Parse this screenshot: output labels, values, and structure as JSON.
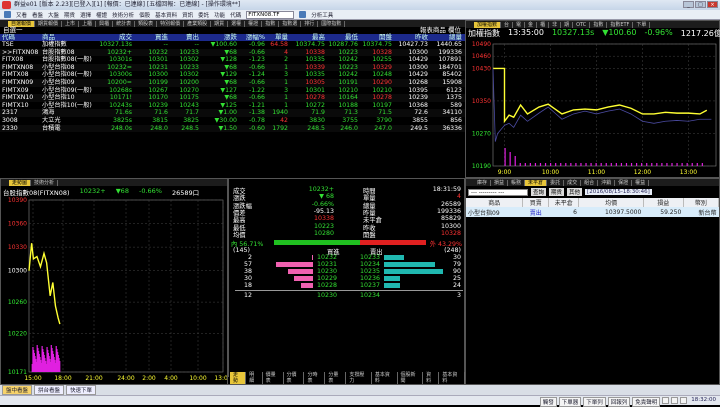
{
  "window": {
    "title": "群益e01 [版本 2.23][已登入][1] [報價：已連線] [五檔回報：已連線] - [操作環境**]",
    "buttons": [
      "_",
      "□",
      "×"
    ]
  },
  "toolbar": {
    "items": [
      "又看",
      "看盤",
      "大盤",
      "期貨",
      "選擇",
      "權證",
      "技術分析",
      "個股",
      "基本資料",
      "資訊",
      "委託",
      "功能"
    ],
    "code_label": "代碼",
    "code_value": "FITXN08.TF",
    "analysis": "分析工具"
  },
  "top_tabs": [
    "自選報價",
    "期貨報價",
    "上市",
    "上櫃",
    "興櫃",
    "統計表",
    "類股表",
    "特別報價",
    "產業類股",
    "期貨",
    "選權",
    "權證",
    "指數",
    "指數選",
    "排行",
    "國際指數"
  ],
  "watchlist": {
    "title": "自選一",
    "right_buttons": [
      "報表商品",
      "欄位"
    ],
    "headers": [
      "代碼",
      "商品",
      "成交",
      "買進",
      "賣出",
      "漲跌",
      "漲幅%",
      "單量",
      "最高",
      "最低",
      "開盤",
      "昨收",
      "總量"
    ],
    "rows": [
      [
        "TSE",
        "加權指數",
        "10327.13s",
        "--",
        "--",
        "▼100.60",
        "-0.96",
        "64.58",
        "10374.75",
        "10287.76",
        "10374.75",
        "10427.73",
        "1440.65"
      ],
      [
        ">>FITXN08",
        "台股指數08",
        "10232+",
        "10232",
        "10233",
        "▼68",
        "-0.66",
        "4",
        "10338",
        "10223",
        "10328",
        "10300",
        "199336"
      ],
      [
        "FITX08",
        "台股指數08(一般)",
        "10301s",
        "10301",
        "10302",
        "▼128",
        "-1.23",
        "2",
        "10335",
        "10242",
        "10255",
        "10429",
        "107891"
      ],
      [
        "FIMTXN08",
        "小型台指08",
        "10232=",
        "10231",
        "10233",
        "▼68",
        "-0.66",
        "1",
        "10339",
        "10223",
        "10329",
        "10300",
        "184701"
      ],
      [
        "FIMTX08",
        "小型台指08(一般)",
        "10300s",
        "10300",
        "10302",
        "▼129",
        "-1.24",
        "3",
        "10335",
        "10242",
        "10248",
        "10429",
        "85402"
      ],
      [
        "FIMTXN09",
        "小型台指09",
        "10200=",
        "10199",
        "10200",
        "▼68",
        "-0.66",
        "1",
        "10305",
        "10191",
        "10290",
        "10268",
        "15908"
      ],
      [
        "FIMTX09",
        "小型台指09(一般)",
        "10268s",
        "10267",
        "10270",
        "▼127",
        "-1.22",
        "3",
        "10301",
        "10210",
        "10210",
        "10395",
        "6123"
      ],
      [
        "FIMTXN10",
        "小型台指10",
        "10171!",
        "10170",
        "10175",
        "▼68",
        "-0.66",
        "1",
        "10278",
        "10164",
        "10278",
        "10239",
        "1375"
      ],
      [
        "FIMTX10",
        "小型台指10(一般)",
        "10243s",
        "10239",
        "10243",
        "▼125",
        "-1.21",
        "1",
        "10272",
        "10188",
        "10197",
        "10368",
        "589"
      ],
      [
        "2317",
        "鴻海",
        "71.6s",
        "71.6",
        "71.7",
        "▼1.00",
        "-1.38",
        "1940",
        "71.9",
        "71.3",
        "71.5",
        "72.6",
        "34110"
      ],
      [
        "3008",
        "大立光",
        "3825s",
        "3815",
        "3825",
        "▼30.00",
        "-0.78",
        "42",
        "3830",
        "3755",
        "3790",
        "3855",
        "856"
      ],
      [
        "2330",
        "台積電",
        "248.0s",
        "248.0",
        "248.5",
        "▼1.50",
        "-0.60",
        "1792",
        "248.5",
        "246.0",
        "247.0",
        "249.5",
        "36336"
      ]
    ]
  },
  "index_chart": {
    "tabs": [
      "加權指數",
      "台",
      "電",
      "金",
      "櫃",
      "非",
      "期",
      "OTC",
      "指數",
      "指數ETF",
      "下單"
    ],
    "name": "加權指數",
    "time": "13:35:00",
    "price": "10327.13s",
    "change": "▼100.60",
    "pct": "-0.96%",
    "amount": "1217.26億"
  },
  "futures_chart": {
    "tabs": [
      "走勢圖",
      "技術分析"
    ],
    "name": "台股指數08(FITXN08)",
    "price": "10232+",
    "change": "▼68",
    "pct": "-0.66%",
    "volume": "26589口",
    "bottom_tabs": [
      "走勢",
      "明細",
      "價量表",
      "分價表",
      "分時表",
      "分量表",
      "支撐壓力",
      "基本資料",
      "個股新聞",
      "資料",
      "基本資料"
    ]
  },
  "chart_data": [
    {
      "type": "line",
      "title": "加權指數",
      "y_ticks": [
        10490,
        10460,
        10430,
        10350,
        10270,
        10190
      ],
      "ylim": [
        10190,
        10490
      ],
      "x_ticks": [
        "9:00",
        "10:00",
        "11:00",
        "12:00",
        "13:00"
      ],
      "xlim": [
        8.75,
        13.6
      ],
      "series": [
        {
          "name": "加權指數",
          "color": "#ffff33",
          "x": [
            8.75,
            9.0,
            9.0,
            9.1,
            9.2,
            9.35,
            9.5,
            9.75,
            9.95,
            10.1,
            10.25,
            10.5,
            10.75,
            11.0,
            11.25,
            11.5,
            11.75,
            12.0,
            12.25,
            12.5,
            12.75,
            13.0,
            13.25,
            13.4
          ],
          "y": [
            10430,
            10430,
            10300,
            10315,
            10310,
            10340,
            10318,
            10335,
            10342,
            10330,
            10318,
            10328,
            10330,
            10328,
            10335,
            10340,
            10332,
            10318,
            10318,
            10322,
            10320,
            10320,
            10318,
            10327
          ]
        },
        {
          "name": "未加權",
          "color": "#4a4aa0",
          "x": [
            8.75,
            8.8,
            8.85,
            9.0,
            9.1,
            9.2,
            9.35,
            9.5,
            9.75,
            9.95,
            10.1,
            10.25,
            10.5,
            10.75,
            11.0,
            11.25,
            11.5,
            11.75,
            12.0,
            12.25,
            12.5,
            12.75,
            13.0,
            13.25,
            13.5
          ],
          "y": [
            10430,
            10250,
            10270,
            10290,
            10295,
            10285,
            10315,
            10300,
            10320,
            10335,
            10320,
            10305,
            10318,
            10325,
            10318,
            10325,
            10330,
            10318,
            10300,
            10295,
            10300,
            10302,
            10300,
            10305,
            10305
          ]
        }
      ]
    },
    {
      "type": "line",
      "title": "台股指數08(FITXN08)",
      "y_ticks": [
        10390,
        10360,
        10330,
        10300,
        10260,
        10220,
        10171
      ],
      "ylim": [
        10171,
        10390
      ],
      "x_ticks": [
        "15:00",
        "18:00",
        "21:00",
        "24:00",
        "2:00",
        "4:00",
        "10:00",
        "13:00"
      ],
      "series": [
        {
          "name": "FITXN08",
          "color": "#ffff33",
          "x": [
            0,
            0.3,
            0.5,
            0.9,
            1.3,
            1.7,
            2.0,
            2.4,
            2.7,
            3.0,
            3.3,
            3.5
          ],
          "y": [
            10300,
            10335,
            10315,
            10318,
            10305,
            10322,
            10310,
            10268,
            10285,
            10255,
            10240,
            10232
          ]
        }
      ]
    }
  ],
  "quote": {
    "left": [
      [
        "成交",
        "10232+"
      ],
      [
        "漲跌",
        "▼ 68"
      ],
      [
        "漲跌幅",
        "-0.66%"
      ],
      [
        "價差",
        "-95.13"
      ],
      [
        "最高",
        "10338"
      ],
      [
        "最低",
        "10223"
      ],
      [
        "均價",
        "10280"
      ]
    ],
    "right": [
      [
        "時間",
        "18:31:59"
      ],
      [
        "單量",
        "4"
      ],
      [
        "總量",
        "26589"
      ],
      [
        "昨量",
        "199336"
      ],
      [
        "未平倉",
        "85829"
      ],
      [
        "昨收",
        "10300"
      ],
      [
        "開盤",
        "10328"
      ]
    ],
    "inner_label": "內 56.71%",
    "outer_label": "外 43.29%",
    "inner_ratio": 0.5671,
    "bid_total": "(145)",
    "ask_total": "(248)",
    "bid_header": "買進",
    "ask_header": "賣出",
    "book": [
      [
        "2",
        "10232",
        "10233",
        "30"
      ],
      [
        "57",
        "10231",
        "10234",
        "79"
      ],
      [
        "38",
        "10230",
        "10235",
        "90"
      ],
      [
        "30",
        "10229",
        "10236",
        "25"
      ],
      [
        "18",
        "10228",
        "10237",
        "24"
      ]
    ],
    "summary": [
      "12",
      "10230",
      "10234",
      "3"
    ]
  },
  "positions": {
    "tabs": [
      "庫存",
      "損益",
      "帳務",
      "未平倉",
      "委託",
      "成交",
      "組合",
      "沖銷",
      "保證",
      "權益"
    ],
    "active_tab": 3,
    "account": "--- --------- ---",
    "query": "查詢",
    "type": "期貨",
    "other": "其他",
    "timestamp": "[2016/08/15-18:30:46]",
    "headers": [
      "商品",
      "買賣",
      "未平倉",
      "均價",
      "損益",
      "幣別"
    ],
    "rows": [
      [
        "小型台指09",
        "賣出",
        "6",
        "10397.5000",
        "59.250",
        "新台幣"
      ]
    ]
  },
  "window_tabs": [
    "盤中看盤",
    "拼台看盤",
    "快速下單"
  ],
  "status": {
    "items": [
      "觸發",
      "下單器",
      "下單列",
      "回報列",
      "免責聲明"
    ],
    "clock": "18:32:00"
  }
}
